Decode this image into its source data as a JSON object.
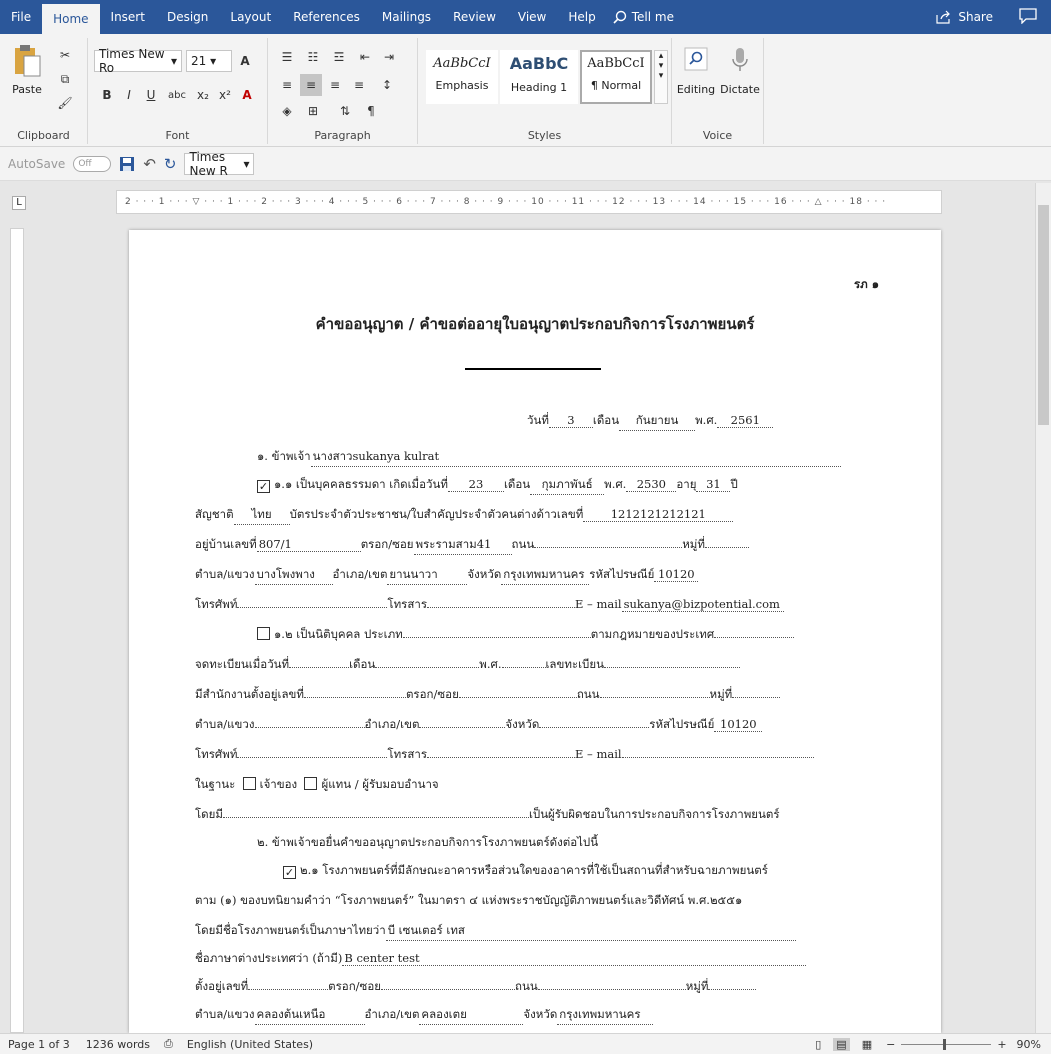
{
  "tabs": [
    "File",
    "Home",
    "Insert",
    "Design",
    "Layout",
    "References",
    "Mailings",
    "Review",
    "View",
    "Help"
  ],
  "tell_me": "Tell me",
  "share": "Share",
  "clipboard": {
    "paste": "Paste",
    "label": "Clipboard"
  },
  "font": {
    "name": "Times New Ro",
    "size": "21",
    "label": "Font"
  },
  "paragraph": {
    "label": "Paragraph"
  },
  "styles": {
    "label": "Styles",
    "items": [
      "AaBbCcI",
      "AaBbC",
      "AaBbCcI"
    ],
    "names": [
      "Emphasis",
      "Heading 1",
      "¶ Normal"
    ]
  },
  "editing": "Editing",
  "dictate": "Dictate",
  "voice": "Voice",
  "qat": {
    "autosave": "AutoSave",
    "toggle": "Off",
    "font": "Times New R"
  },
  "doc": {
    "corner": "รภ ๑",
    "title": "คำขออนุญาต / คำขอต่ออายุใบอนุญาตประกอบกิจการโรงภาพยนตร์",
    "date": {
      "day_label": "วันที่",
      "day": "3",
      "month_label": "เดือน",
      "month": "กันยายน",
      "year_label": "พ.ศ.",
      "year": "2561"
    },
    "l1": {
      "t": "๑.  ข้าพเจ้า",
      "v": "นางสาวsukanya kulrat"
    },
    "l2": {
      "a": "๑.๑  เป็นบุคคลธรรมดา เกิดเมื่อวันที่",
      "d": "23",
      "b": "เดือน",
      "m": "กุมภาพันธ์",
      "c": "พ.ศ.",
      "y": "2530",
      "e": "อายุ",
      "age": "31",
      "f": "ปี"
    },
    "l3": {
      "a": "สัญชาติ",
      "n": "ไทย",
      "b": "บัตรประจำตัวประชาชน/ใบสำคัญประจำตัวคนต่างด้าวเลขที่",
      "id": "1212121212121"
    },
    "l4": {
      "a": "อยู่บ้านเลขที่",
      "no": "807/1",
      "b": "ตรอก/ซอย",
      "soi": "พระรามสาม41",
      "c": "ถนน",
      "d": "หมู่ที่"
    },
    "l5": {
      "a": "ตำบล/แขวง",
      "t": "บางโพงพาง",
      "b": "อำเภอ/เขต",
      "d": "ยานนาวา",
      "c": "จังหวัด",
      "p": "กรุงเทพมหานคร",
      "e": "รหัสไปรษณีย์",
      "z": "10120"
    },
    "l6": {
      "a": "โทรศัพท์",
      "b": "โทรสาร",
      "c": "E – mail",
      "mail": "sukanya@bizpotential.com"
    },
    "l7": {
      "a": "๑.๒  เป็นนิติบุคคล ประเภท",
      "b": "ตามกฎหมายของประเทศ"
    },
    "l8": {
      "a": "จดทะเบียนเมื่อวันที่",
      "b": "เดือน",
      "c": "พ.ศ.",
      "d": "เลขทะเบียน"
    },
    "l9": {
      "a": "มีสำนักงานตั้งอยู่เลขที่",
      "b": "ตรอก/ซอย",
      "c": "ถนน",
      "d": "หมู่ที่"
    },
    "l10": {
      "a": "ตำบล/แขวง",
      "b": "อำเภอ/เขต",
      "c": "จังหวัด",
      "d": "รหัสไปรษณีย์",
      "z": "10120"
    },
    "l11": {
      "a": "โทรศัพท์",
      "b": "โทรสาร",
      "c": "E – mail"
    },
    "l12": {
      "a": "ในฐานะ",
      "b": "เจ้าของ",
      "c": "ผู้แทน / ผู้รับมอบอำนาจ"
    },
    "l13": {
      "a": "โดยมี",
      "b": "เป็นผู้รับผิดชอบในการประกอบกิจการโรงภาพยนตร์"
    },
    "l14": "๒.  ข้าพเจ้าขอยื่นคำขออนุญาตประกอบกิจการโรงภาพยนตร์ดังต่อไปนี้",
    "l15": "๒.๑  โรงภาพยนตร์ที่มีลักษณะอาคารหรือส่วนใดของอาคารที่ใช้เป็นสถานที่สำหรับฉายภาพยนตร์",
    "l16": "ตาม (๑) ของบทนิยามคำว่า “โรงภาพยนตร์” ในมาตรา ๔  แห่งพระราชบัญญัติภาพยนตร์และวิดีทัศน์ พ.ศ.๒๕๕๑",
    "l17": {
      "a": "โดยมีชื่อโรงภาพยนตร์เป็นภาษาไทยว่า",
      "v": "บี เซนเตอร์ เทส"
    },
    "l18": {
      "a": "ชื่อภาษาต่างประเทศว่า  (ถ้ามี)",
      "v": "B center test"
    },
    "l19": {
      "a": "ตั้งอยู่เลขที่",
      "b": "ตรอก/ซอย",
      "c": "ถนน",
      "d": "หมู่ที่"
    },
    "l20": {
      "a": "ตำบล/แขวง",
      "t": "คลองต้นเหนือ",
      "b": "อำเภอ/เขต",
      "d": "คลองเตย",
      "c": "จังหวัด",
      "p": "กรุงเทพมหานคร"
    }
  },
  "status": {
    "page": "Page 1 of 3",
    "words": "1236 words",
    "lang": "English (United States)",
    "zoom": "90%"
  }
}
